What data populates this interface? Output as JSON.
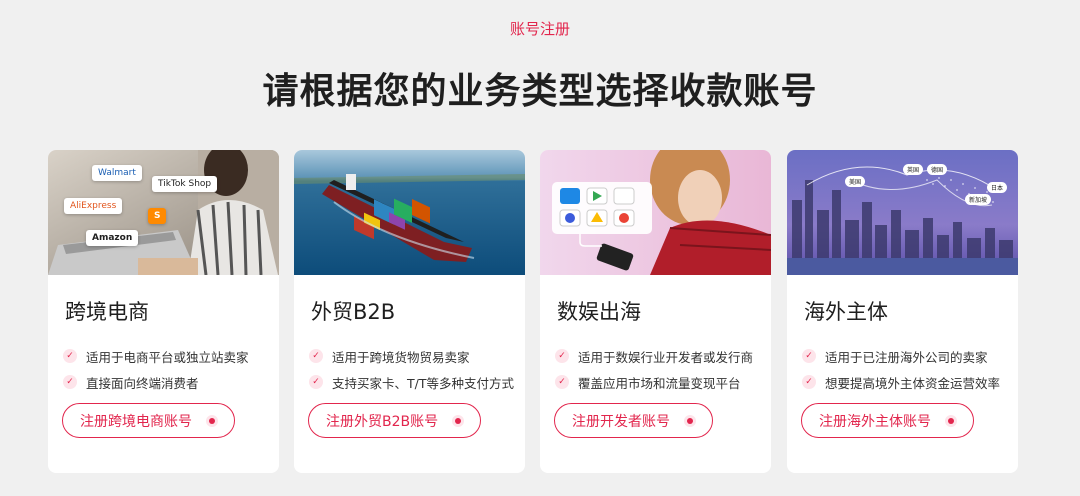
{
  "header": {
    "eyebrow": "账号注册",
    "title": "请根据您的业务类型选择收款账号"
  },
  "cards": [
    {
      "title": "跨境电商",
      "features": [
        "适用于电商平台或独立站卖家",
        "直接面向终端消费者"
      ],
      "cta_label": "注册跨境电商账号",
      "hero_logos": [
        "Walmart",
        "TikTok Shop",
        "AliExpress",
        "Amazon"
      ]
    },
    {
      "title": "外贸B2B",
      "features": [
        "适用于跨境货物贸易卖家",
        "支持买家卡、T/T等多种支付方式"
      ],
      "cta_label": "注册外贸B2B账号"
    },
    {
      "title": "数娱出海",
      "features": [
        "适用于数娱行业开发者或发行商",
        "覆盖应用市场和流量变现平台"
      ],
      "cta_label": "注册开发者账号"
    },
    {
      "title": "海外主体",
      "features": [
        "适用于已注册海外公司的卖家",
        "想要提高境外主体资金运营效率"
      ],
      "cta_label": "注册海外主体账号",
      "hero_tags": [
        "美国",
        "英国",
        "德国",
        "日本",
        "新加坡"
      ]
    }
  ],
  "colors": {
    "accent": "#e2264d",
    "accent_soft": "#fde4ea",
    "background": "#f0f0f0"
  },
  "icons": {
    "feature": "check-icon",
    "cta": "dot-icon"
  }
}
